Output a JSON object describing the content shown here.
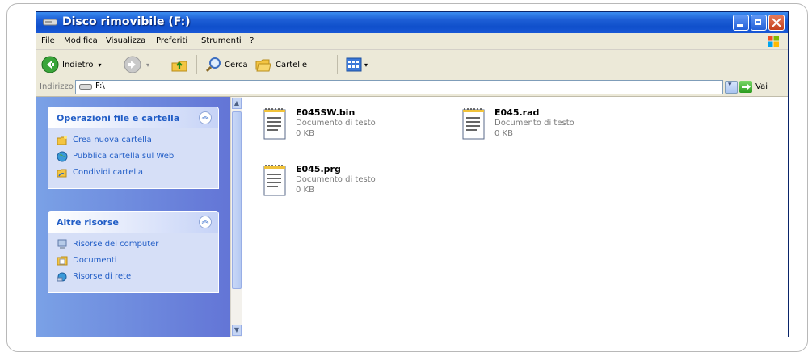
{
  "window": {
    "title": "Disco rimovibile (F:)"
  },
  "menu": [
    "File",
    "Modifica",
    "Visualizza",
    "Preferiti",
    "Strumenti",
    "?"
  ],
  "toolbar": {
    "back": "Indietro",
    "search": "Cerca",
    "folders": "Cartelle"
  },
  "address": {
    "label": "Indirizzo",
    "value": "F:\\",
    "go": "Vai"
  },
  "tasks": {
    "title": "Operazioni file e cartella",
    "items": [
      "Crea nuova cartella",
      "Pubblica cartella sul Web",
      "Condividi cartella"
    ]
  },
  "other": {
    "title": "Altre risorse",
    "items": [
      "Risorse del computer",
      "Documenti",
      "Risorse di rete"
    ]
  },
  "files": [
    {
      "name": "E045SW.bin",
      "type": "Documento di testo",
      "size": "0 KB"
    },
    {
      "name": "E045.rad",
      "type": "Documento di testo",
      "size": "0 KB"
    },
    {
      "name": "E045.prg",
      "type": "Documento di testo",
      "size": "0 KB"
    }
  ],
  "colors": {
    "titlebar": "#0f4fcb",
    "taskpane": "#6375d6",
    "panelTitle": "#215dc6"
  },
  "icons": [
    "drive-icon",
    "back-icon",
    "forward-icon",
    "up-folder-icon",
    "search-icon",
    "folders-icon",
    "views-icon",
    "go-icon",
    "new-folder-icon",
    "web-publish-icon",
    "share-folder-icon",
    "my-computer-icon",
    "documents-icon",
    "network-icon",
    "text-document-icon"
  ]
}
